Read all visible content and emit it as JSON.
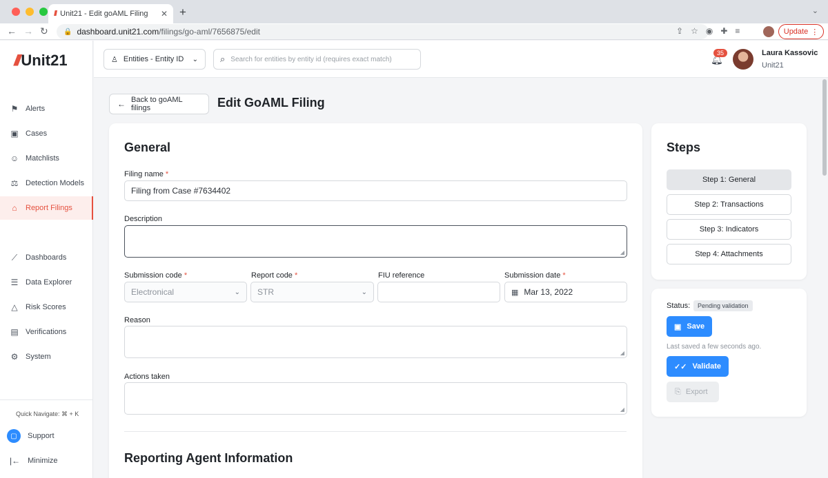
{
  "browser": {
    "tab_title": "Unit21 - Edit goAML Filing",
    "tab_favicon": "///",
    "tab_close": "✕",
    "new_tab": "+",
    "url_host": "dashboard.unit21.com",
    "url_path": "/filings/go-aml/7656875/edit",
    "update_label": "Update",
    "traffic_colors": [
      "#ff5f57",
      "#febc2e",
      "#28c840"
    ]
  },
  "logo": {
    "slashes": "///",
    "text": "Unit21"
  },
  "sidebar": {
    "items": [
      {
        "label": "Alerts",
        "icon": "flag-icon"
      },
      {
        "label": "Cases",
        "icon": "briefcase-icon"
      },
      {
        "label": "Matchlists",
        "icon": "user-x-icon"
      },
      {
        "label": "Detection Models",
        "icon": "scale-icon"
      },
      {
        "label": "Report Filings",
        "icon": "bank-icon"
      },
      {
        "label": "Dashboards",
        "icon": "trend-icon"
      },
      {
        "label": "Data Explorer",
        "icon": "search-list-icon"
      },
      {
        "label": "Risk Scores",
        "icon": "warning-icon"
      },
      {
        "label": "Verifications",
        "icon": "id-card-icon"
      },
      {
        "label": "System",
        "icon": "gear-icon"
      }
    ],
    "active": "Report Filings",
    "quick_navigate": "Quick Navigate: ⌘ + K",
    "support_label": "Support",
    "minimize_label": "Minimize"
  },
  "topbar": {
    "entity_select": "Entities - Entity ID",
    "search_placeholder": "Search for entities by entity id (requires exact match)",
    "notification_count": "35",
    "user_name": "Laura Kassovic",
    "user_org": "Unit21"
  },
  "header": {
    "back_label": "Back to goAML filings",
    "title": "Edit GoAML Filing"
  },
  "general": {
    "title": "General",
    "filing_name_label": "Filing name",
    "filing_name_value": "Filing from Case #7634402",
    "description_label": "Description",
    "description_value": "",
    "submission_code_label": "Submission code",
    "submission_code_value": "Electronical",
    "report_code_label": "Report code",
    "report_code_value": "STR",
    "fiu_reference_label": "FIU reference",
    "fiu_reference_value": "",
    "submission_date_label": "Submission date",
    "submission_date_value": "Mar 13, 2022",
    "reason_label": "Reason",
    "actions_label": "Actions taken",
    "required_marker": "*",
    "next_section_title": "Reporting Agent Information"
  },
  "steps": {
    "title": "Steps",
    "items": [
      "Step 1: General",
      "Step 2: Transactions",
      "Step 3: Indicators",
      "Step 4: Attachments"
    ],
    "active_index": 0
  },
  "status": {
    "label": "Status:",
    "badge": "Pending validation",
    "save_label": "Save",
    "last_saved": "Last saved a few seconds ago.",
    "validate_label": "Validate",
    "export_label": "Export"
  },
  "colors": {
    "brand": "#e5513f",
    "primary": "#2d8cff"
  }
}
